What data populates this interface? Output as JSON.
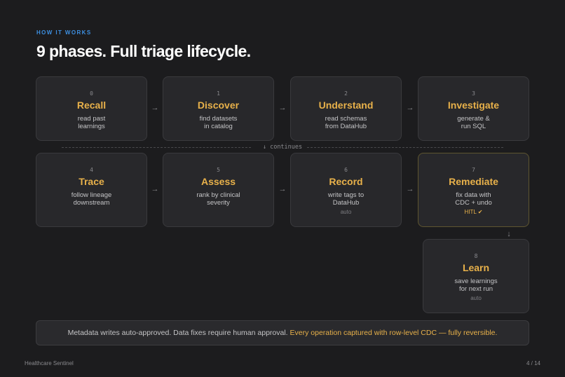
{
  "eyebrow": "HOW IT WORKS",
  "title": "9 phases. Full triage lifecycle.",
  "colors": {
    "background": "#1c1c1e",
    "card": "#28282b",
    "accent": "#e8b14a",
    "eyebrow": "#3d8fe0"
  },
  "phases": [
    {
      "num": "0",
      "name": "Recall",
      "desc": "read past\nlearnings",
      "tag": ""
    },
    {
      "num": "1",
      "name": "Discover",
      "desc": "find datasets\nin catalog",
      "tag": ""
    },
    {
      "num": "2",
      "name": "Understand",
      "desc": "read schemas\nfrom DataHub",
      "tag": ""
    },
    {
      "num": "3",
      "name": "Investigate",
      "desc": "generate &\nrun SQL",
      "tag": ""
    },
    {
      "num": "4",
      "name": "Trace",
      "desc": "follow lineage\ndownstream",
      "tag": ""
    },
    {
      "num": "5",
      "name": "Assess",
      "desc": "rank by clinical\nseverity",
      "tag": ""
    },
    {
      "num": "6",
      "name": "Record",
      "desc": "write tags to\nDataHub",
      "tag": "auto"
    },
    {
      "num": "7",
      "name": "Remediate",
      "desc": "fix data with\nCDC + undo",
      "tag": "HITL ✔"
    },
    {
      "num": "8",
      "name": "Learn",
      "desc": "save learnings\nfor next run",
      "tag": "auto"
    }
  ],
  "arrows": {
    "right": "→",
    "down": "↓"
  },
  "continues_label": "↓ continues",
  "notice": {
    "text": "Metadata writes auto-approved. Data fixes require human approval.",
    "accent": "Every operation captured with row-level CDC — fully reversible."
  },
  "footer": {
    "left": "Healthcare Sentinel",
    "right": "4 / 14"
  }
}
